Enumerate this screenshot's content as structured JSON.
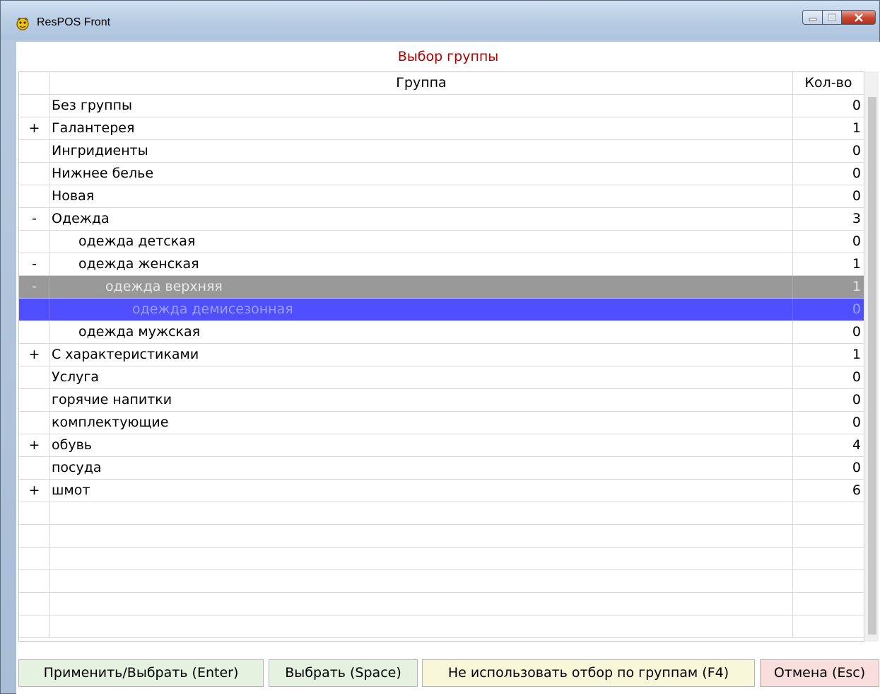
{
  "window": {
    "title": "ResPOS Front"
  },
  "dialog": {
    "title": "Выбор группы"
  },
  "columns": {
    "expander": "",
    "group": "Группа",
    "qty": "Кол-во"
  },
  "rows": [
    {
      "expander": "",
      "level": 0,
      "name": "Без группы",
      "qty": "0"
    },
    {
      "expander": "+",
      "level": 0,
      "name": "Галантерея",
      "qty": "1"
    },
    {
      "expander": "",
      "level": 0,
      "name": "Ингридиенты",
      "qty": "0"
    },
    {
      "expander": "",
      "level": 0,
      "name": "Нижнее белье",
      "qty": "0"
    },
    {
      "expander": "",
      "level": 0,
      "name": "Новая",
      "qty": "0"
    },
    {
      "expander": "-",
      "level": 0,
      "name": "Одежда",
      "qty": "3"
    },
    {
      "expander": "",
      "level": 1,
      "name": "одежда детская",
      "qty": "0"
    },
    {
      "expander": "-",
      "level": 1,
      "name": "одежда женская",
      "qty": "1"
    },
    {
      "expander": "-",
      "level": 2,
      "name": "одежда верхняя",
      "qty": "1",
      "state": "selected-parent"
    },
    {
      "expander": "",
      "level": 3,
      "name": "одежда демисезонная",
      "qty": "0",
      "state": "current"
    },
    {
      "expander": "",
      "level": 1,
      "name": "одежда мужская",
      "qty": "0"
    },
    {
      "expander": "+",
      "level": 0,
      "name": "С характеристиками",
      "qty": "1"
    },
    {
      "expander": "",
      "level": 0,
      "name": "Услуга",
      "qty": "0"
    },
    {
      "expander": "",
      "level": 0,
      "name": "горячие напитки",
      "qty": "0"
    },
    {
      "expander": "",
      "level": 0,
      "name": "комплектующие",
      "qty": "0"
    },
    {
      "expander": "+",
      "level": 0,
      "name": "обувь",
      "qty": "4"
    },
    {
      "expander": "",
      "level": 0,
      "name": "посуда",
      "qty": "0"
    },
    {
      "expander": "+",
      "level": 0,
      "name": "шмот",
      "qty": "6"
    }
  ],
  "empty_rows": 6,
  "buttons": {
    "apply": "Применить/Выбрать (Enter)",
    "select": "Выбрать (Space)",
    "no_filter": "Не использовать отбор по группам (F4)",
    "cancel": "Отмена (Esc)"
  },
  "colors": {
    "dialog_title": "#b00000",
    "selected_parent_bg": "#999999",
    "current_bg": "#4f4fff",
    "apply_bg": "#e4f2df",
    "no_filter_bg": "#f9f7da",
    "cancel_bg": "#f8dedd"
  }
}
